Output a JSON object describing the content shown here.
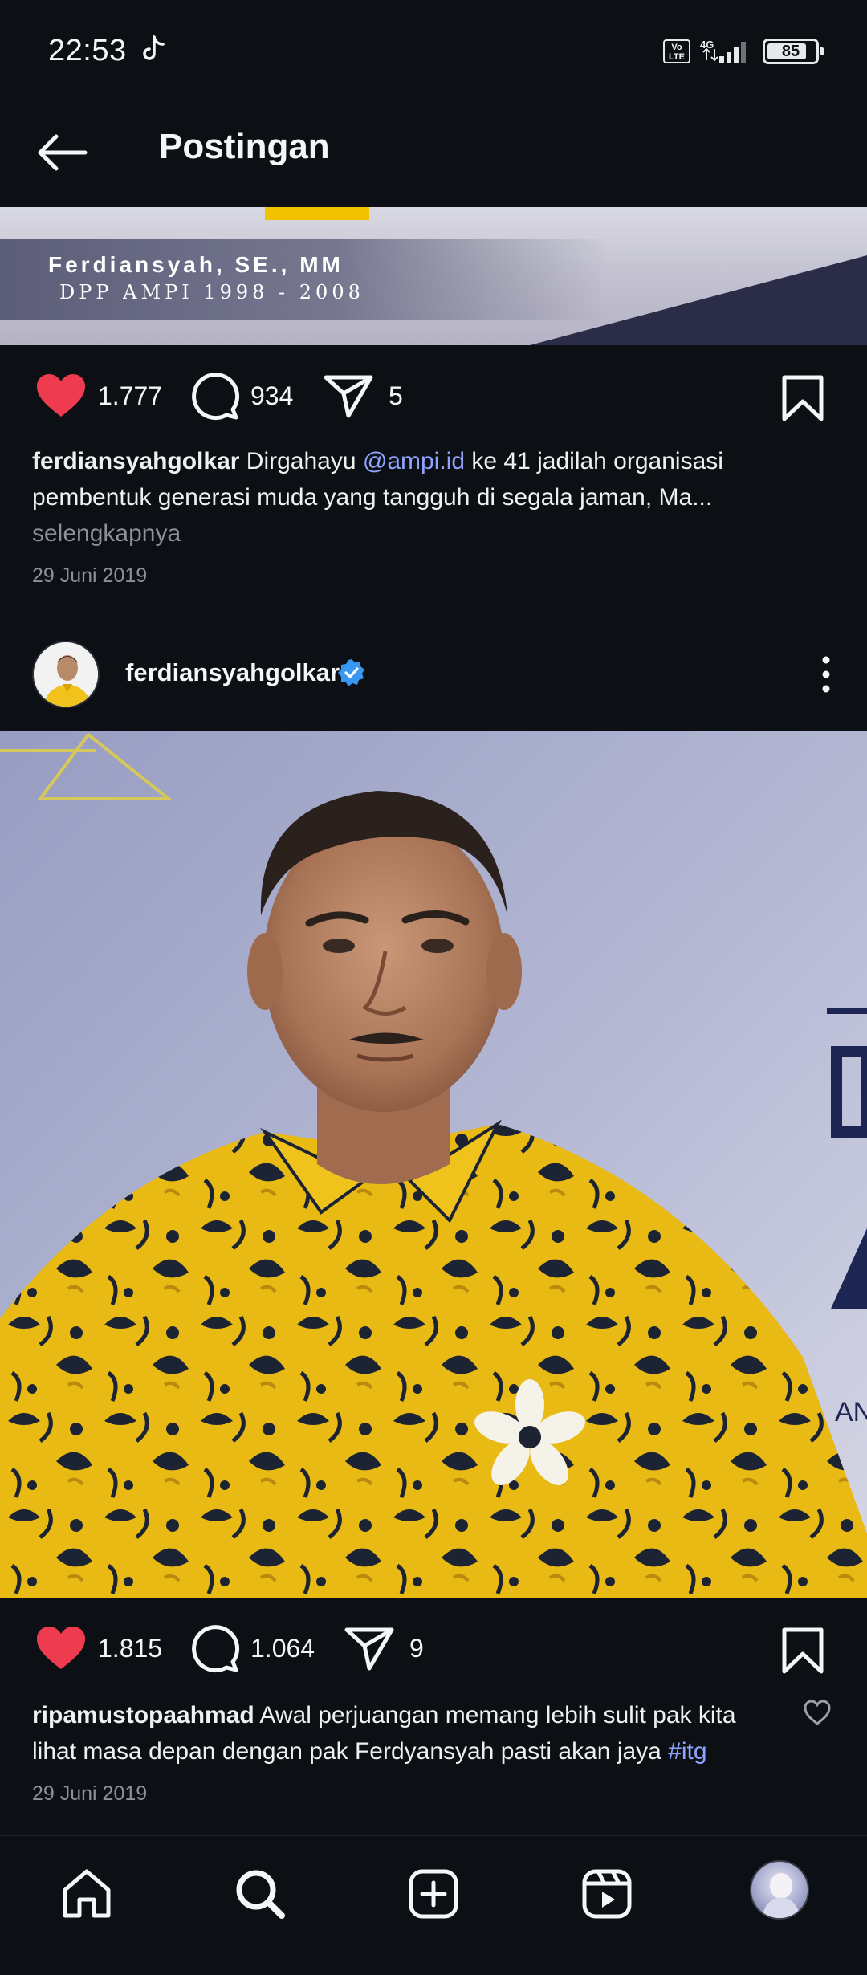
{
  "status_bar": {
    "time": "22:53",
    "network": "4G",
    "volte": "Vo LTE",
    "battery": "85",
    "battery_level": 0.85
  },
  "header": {
    "title": "Postingan"
  },
  "banner": {
    "name": "Ferdiansyah, SE., MM",
    "subtitle": "DPP AMPI 1998 - 2008"
  },
  "post1": {
    "likes": "1.777",
    "comments": "934",
    "shares": "5",
    "caption_user": "ferdiansyahgolkar",
    "caption_pre": "Dirgahayu",
    "caption_mention": "@ampi.id",
    "caption_post": "ke 41 jadilah organisasi pembentuk generasi muda yang tangguh di segala jaman, Ma...",
    "more_label": "selengkapnya",
    "date": "29 Juni 2019"
  },
  "post2": {
    "username": "ferdiansyahgolkar",
    "likes": "1.815",
    "comments": "1.064",
    "shares": "9",
    "comment_user": "ripamustopaahmad",
    "comment_text": "Awal perjuangan memang lebih sulit pak kita lihat masa depan dengan pak Ferdyansyah pasti akan jaya",
    "comment_hashtag": "#itg",
    "date": "29 Juni 2019",
    "photo_partial_text": "AN"
  },
  "nav": {
    "items": [
      "home-icon",
      "search-icon",
      "create-icon",
      "reels-icon",
      "profile-avatar"
    ]
  },
  "colors": {
    "background": "#0c1015",
    "like": "#ef3b4f",
    "link": "#8fa3ff",
    "verified": "#3897f0",
    "muted": "#8c9199"
  }
}
